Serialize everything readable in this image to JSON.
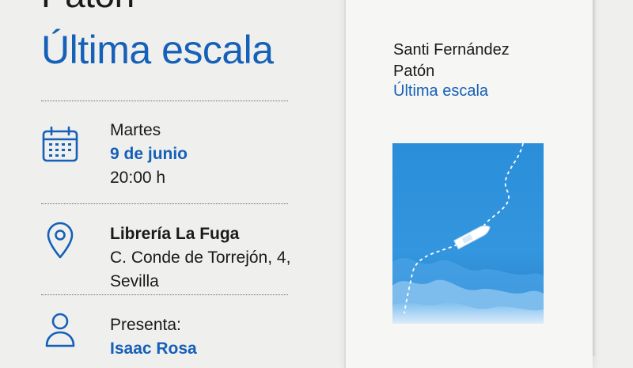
{
  "event": {
    "author_partial": "Patón",
    "title": "Última escala",
    "date": {
      "day": "Martes",
      "date": "9 de junio",
      "time": "20:00 h"
    },
    "place": {
      "name": "Librería La Fuga",
      "address_line1": "C. Conde de Torrejón, 4,",
      "address_line2": "Sevilla"
    },
    "presenter": {
      "label": "Presenta:",
      "name": "Isaac Rosa"
    }
  },
  "book": {
    "author_line1": "Santi Fernández",
    "author_line2": "Patón",
    "title": "Última escala"
  },
  "icons": {
    "date": "calendar-icon",
    "place": "location-pin-icon",
    "presenter": "user-icon"
  },
  "colors": {
    "accent": "#1560b8",
    "background": "#efefed",
    "sea": "#2f8fd8"
  }
}
